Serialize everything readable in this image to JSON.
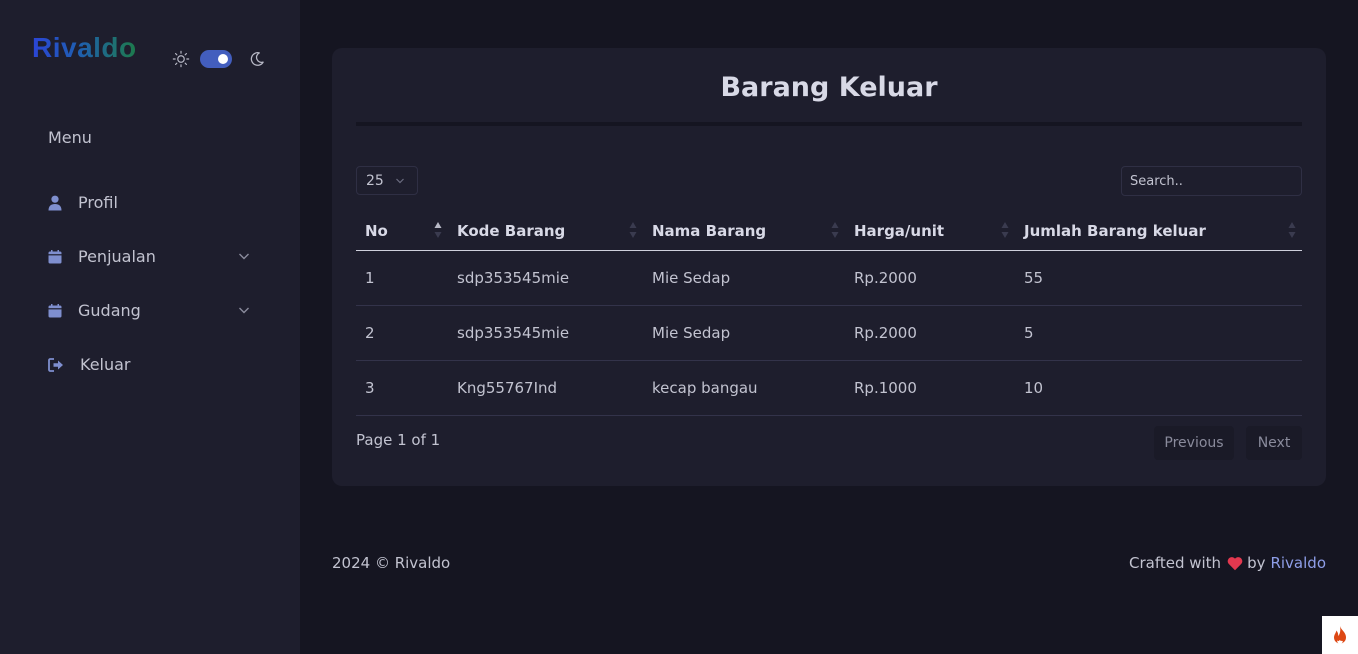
{
  "brand": {
    "name": "Rivaldo"
  },
  "sidebar": {
    "menu_title": "Menu",
    "items": [
      {
        "label": "Profil",
        "icon": "user-icon",
        "has_dropdown": false
      },
      {
        "label": "Penjualan",
        "icon": "folder-icon",
        "has_dropdown": true
      },
      {
        "label": "Gudang",
        "icon": "folder-icon",
        "has_dropdown": true
      },
      {
        "label": "Keluar",
        "icon": "logout-icon",
        "has_dropdown": false
      }
    ]
  },
  "theme": {
    "dark_mode_enabled": true,
    "accent": "#435ebe"
  },
  "main": {
    "title": "Barang Keluar",
    "entries_per_page": "25",
    "search": {
      "placeholder": "Search..",
      "value": ""
    },
    "table": {
      "columns": [
        "No",
        "Kode Barang",
        "Nama Barang",
        "Harga/unit",
        "Jumlah Barang keluar"
      ],
      "rows": [
        [
          "1",
          "sdp353545mie",
          "Mie Sedap",
          "Rp.2000",
          "55"
        ],
        [
          "2",
          "sdp353545mie",
          "Mie Sedap",
          "Rp.2000",
          "5"
        ],
        [
          "3",
          "Kng55767Ind",
          "kecap bangau",
          "Rp.1000",
          "10"
        ]
      ]
    },
    "pagination": {
      "info": "Page 1 of 1",
      "previous": "Previous",
      "next": "Next"
    }
  },
  "footer": {
    "copyright": "2024 © Rivaldo",
    "crafted_prefix": "Crafted with",
    "crafted_by": "by",
    "author_link": "Rivaldo",
    "heart_color": "#e3384f"
  }
}
